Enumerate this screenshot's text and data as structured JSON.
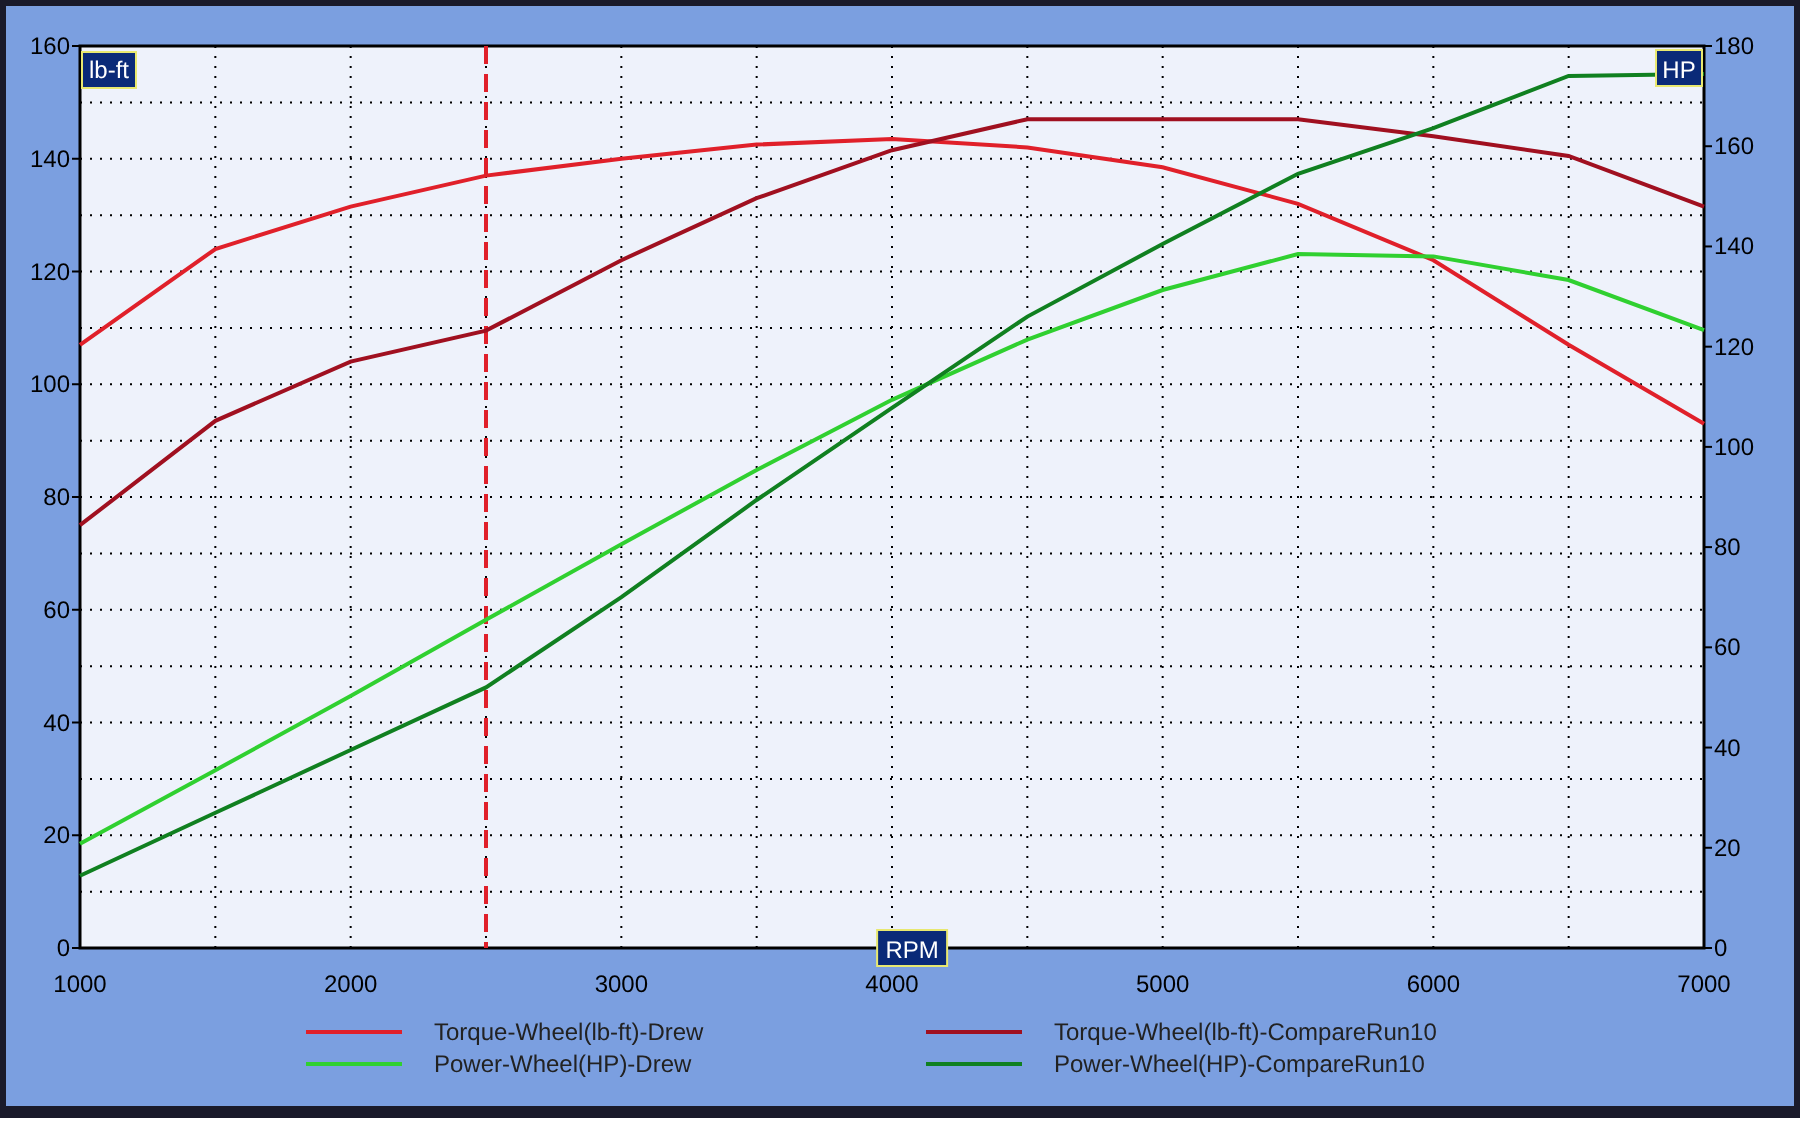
{
  "chart": {
    "chart_data": {
      "type": "line",
      "xlabel": "RPM",
      "ylabel": "lb-ft",
      "x": [
        1000,
        1500,
        2000,
        2500,
        3000,
        3500,
        4000,
        4500,
        5000,
        5500,
        6000,
        6500,
        7000
      ],
      "xlim": [
        1000,
        7000
      ],
      "ylim": [
        0,
        160
      ],
      "xticks": [
        1000,
        2000,
        3000,
        4000,
        5000,
        6000,
        7000
      ],
      "yticks": [
        0,
        20,
        40,
        60,
        80,
        100,
        120,
        140,
        160
      ],
      "series": [
        {
          "name": "Torque-Wheel(lb-ft)-Drew",
          "color": "#e0202a",
          "values": [
            107,
            124,
            131.5,
            137,
            140,
            142.5,
            143.5,
            142,
            138.5,
            132,
            122,
            107,
            93
          ]
        },
        {
          "name": "Torque-Wheel(lb-ft)-CompareRun10",
          "color": "#a01020",
          "values": [
            75,
            93.5,
            104,
            109.5,
            122,
            133,
            141.5,
            147,
            147,
            147,
            144,
            140.5,
            131.5
          ]
        },
        {
          "name": "Power-Wheel(HP)-Drew",
          "color": "#30d030",
          "axis": "y2",
          "values": [
            20.8,
            35.5,
            50.3,
            65.5,
            80.6,
            95.4,
            109.4,
            121.4,
            131.3,
            138.5,
            138,
            133.3,
            123.3
          ]
        },
        {
          "name": "Power-Wheel(HP)-CompareRun10",
          "color": "#108020",
          "axis": "y2",
          "values": [
            14.4,
            27,
            39.5,
            52,
            70,
            89.4,
            107.8,
            126,
            140.5,
            154.5,
            163.6,
            174,
            174.4
          ]
        }
      ],
      "ref_lines": [
        {
          "axis": "x",
          "value": 2500,
          "color": "#e0202a"
        }
      ],
      "grid": true,
      "y2label": "HP",
      "y2lim": [
        0,
        180
      ],
      "y2ticks": [
        0,
        20,
        40,
        60,
        80,
        100,
        120,
        140,
        160,
        180
      ]
    }
  }
}
